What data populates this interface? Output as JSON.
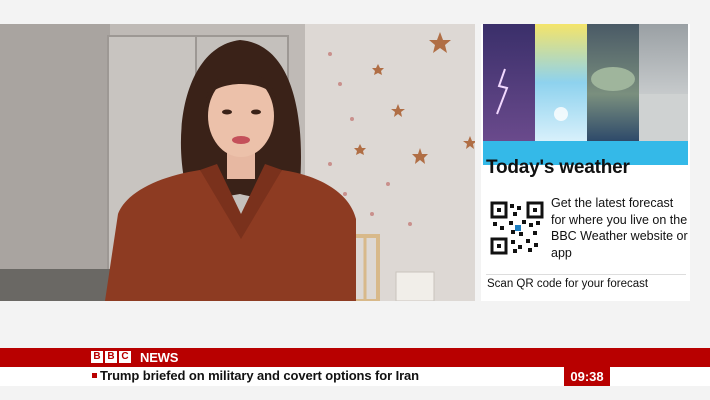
{
  "weather_panel": {
    "title": "Today's weather",
    "description": "Get the latest forecast for where you live on the BBC Weather website or app",
    "scan_text": "Scan QR code for your forecast"
  },
  "branding": {
    "letters": [
      "B",
      "B",
      "C"
    ],
    "news_word": "NEWS"
  },
  "ticker": {
    "headline": "Trump briefed on military and covert options for Iran"
  },
  "clock": {
    "time": "09:38"
  },
  "colors": {
    "brand_red": "#b80000",
    "weather_accent": "#34b9e8",
    "background": "#f3f3f3"
  },
  "icons": {
    "qr": "qr-code-icon"
  }
}
